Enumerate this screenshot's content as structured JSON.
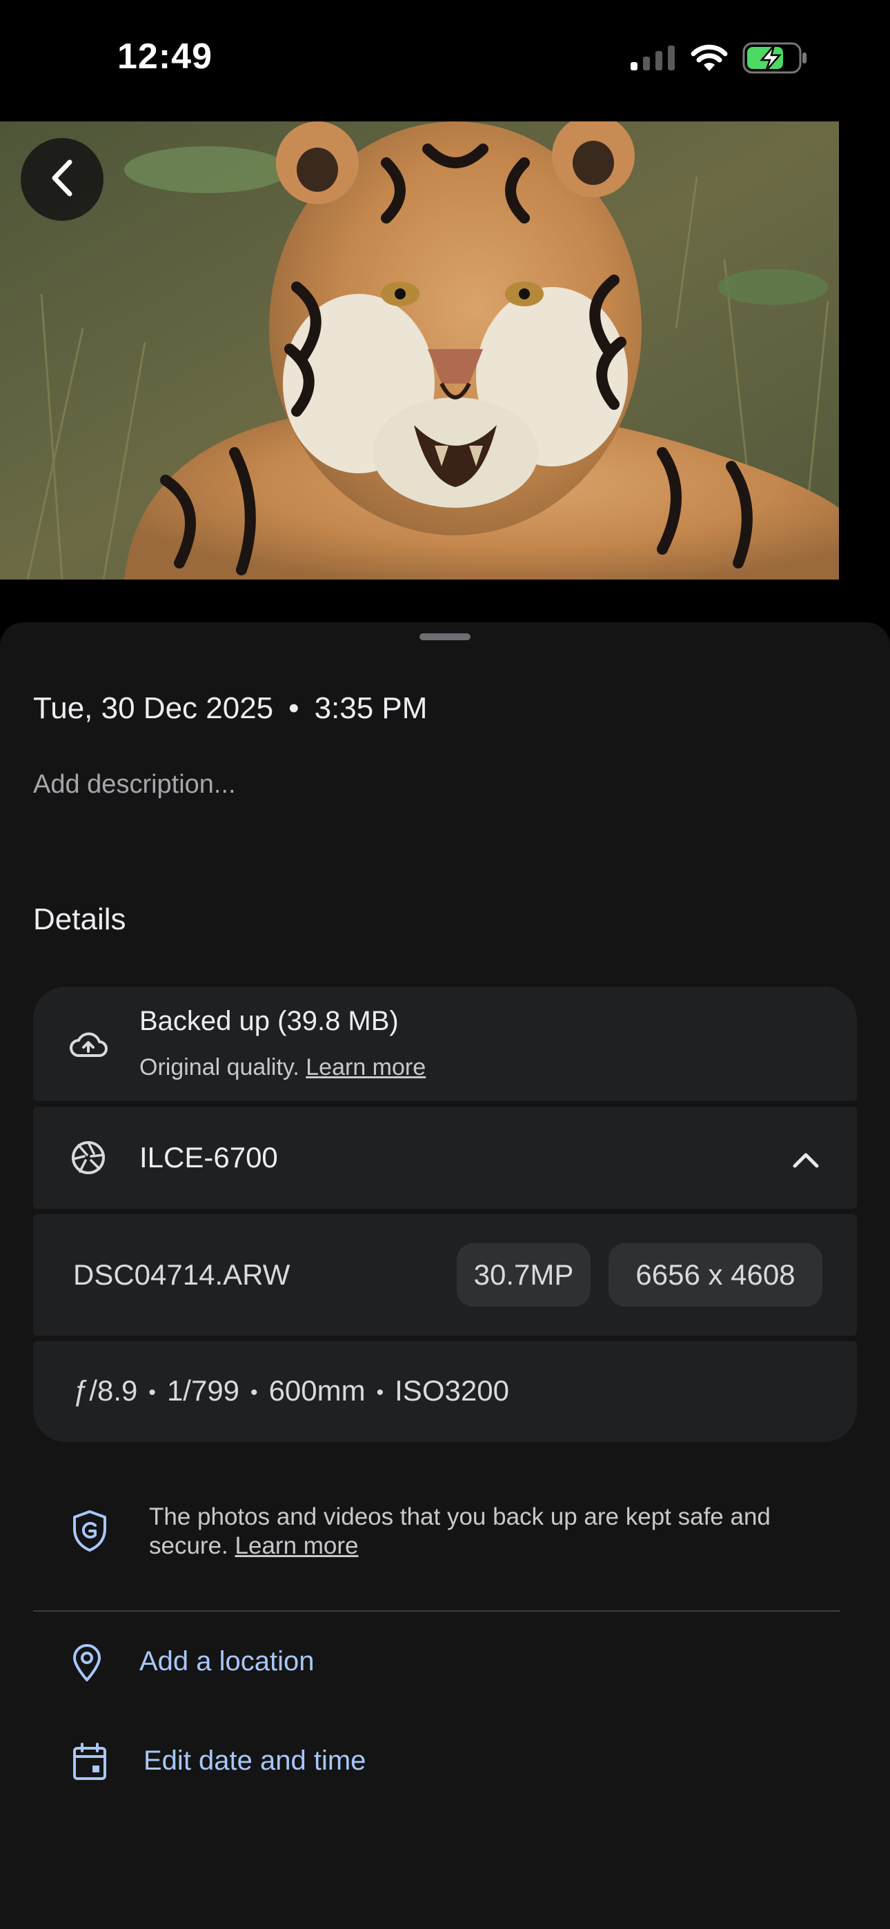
{
  "status_bar": {
    "time": "12:49",
    "icons": [
      "cellular-signal-icon",
      "wifi-icon",
      "battery-charging-icon"
    ],
    "battery_color": "#4cd964"
  },
  "photo": {
    "subject": "tiger-photo"
  },
  "info": {
    "date": "Tue, 30 Dec 2025",
    "separator": "•",
    "time": "3:35 PM",
    "description_placeholder": "Add description..."
  },
  "details": {
    "heading": "Details",
    "backup": {
      "title": "Backed up (39.8 MB)",
      "subtitle": "Original quality.",
      "learn_more": "Learn more"
    },
    "camera": {
      "model": "ILCE-6700"
    },
    "file": {
      "name": "DSC04714.ARW",
      "megapixels": "30.7MP",
      "dimensions": "6656 x 4608"
    },
    "exposure": {
      "aperture": "ƒ/8.9",
      "shutter": "1/799",
      "focal_length": "600mm",
      "iso": "ISO3200",
      "separator": "•"
    }
  },
  "security": {
    "text": "The photos and videos that you back up are kept safe and secure.",
    "learn_more": "Learn more"
  },
  "actions": {
    "add_location": "Add a location",
    "edit_date_time": "Edit date and time"
  },
  "colors": {
    "sheet_bg": "#141414",
    "card_bg": "#1f2022",
    "chip_bg": "#2f3033",
    "accent": "#a8c7fa"
  }
}
